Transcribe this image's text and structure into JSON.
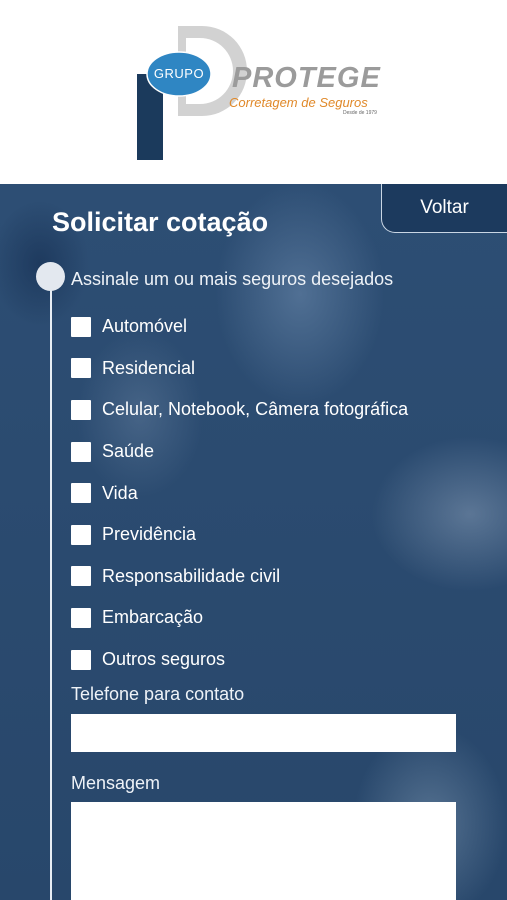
{
  "header": {
    "logo_grupo": "GRUPO",
    "logo_name": "PROTEGE",
    "logo_subtitle": "Corretagem de Seguros",
    "logo_tagline": "Desde de 1979",
    "colors": {
      "logo_navy": "#1b3a5c",
      "logo_blue": "#2f86c3",
      "logo_gray": "#d2d2d2",
      "logo_orange": "#e0892a"
    }
  },
  "form": {
    "title": "Solicitar cotação",
    "back_label": "Voltar",
    "instruction": "Assinale um ou mais seguros desejados",
    "options": [
      {
        "label": "Automóvel",
        "checked": false
      },
      {
        "label": "Residencial",
        "checked": false
      },
      {
        "label": "Celular, Notebook, Câmera fotográfica",
        "checked": false
      },
      {
        "label": "Saúde",
        "checked": false
      },
      {
        "label": "Vida",
        "checked": false
      },
      {
        "label": "Previdência",
        "checked": false
      },
      {
        "label": "Responsabilidade civil",
        "checked": false
      },
      {
        "label": "Embarcação",
        "checked": false
      },
      {
        "label": "Outros seguros",
        "checked": false
      }
    ],
    "phone": {
      "label": "Telefone para contato",
      "value": ""
    },
    "message": {
      "label": "Mensagem",
      "value": ""
    }
  }
}
